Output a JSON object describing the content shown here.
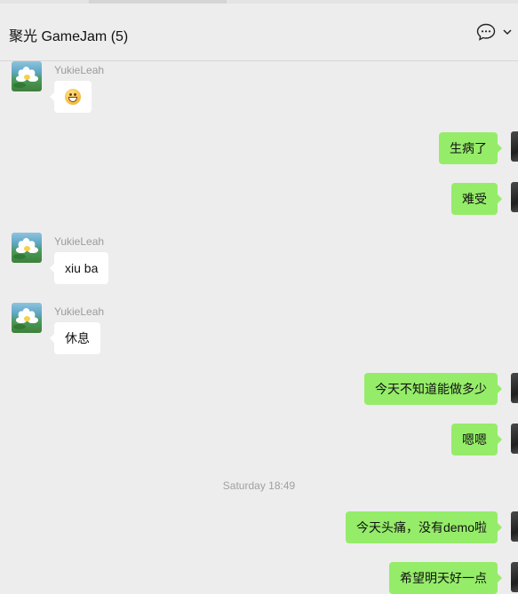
{
  "header": {
    "title": "聚光 GameJam (5)",
    "icons": [
      "chat-bubble-icon",
      "chevron-down-icon"
    ]
  },
  "messages": [
    {
      "sender": "YukieLeah",
      "direction": "in",
      "content": "😄",
      "content_type": "emoji"
    },
    {
      "direction": "out",
      "content": "生病了"
    },
    {
      "direction": "out",
      "content": "难受"
    },
    {
      "sender": "YukieLeah",
      "direction": "in",
      "content": "xiu ba"
    },
    {
      "sender": "YukieLeah",
      "direction": "in",
      "content": "休息"
    },
    {
      "direction": "out",
      "content": "今天不知道能做多少"
    },
    {
      "direction": "out",
      "content": "嗯嗯"
    },
    {
      "direction": "out",
      "content": "今天头痛，没有demo啦"
    },
    {
      "direction": "out",
      "content": "希望明天好一点"
    }
  ],
  "timestamp": "Saturday 18:49",
  "colors": {
    "background": "#ededed",
    "incoming_bubble": "#ffffff",
    "outgoing_bubble": "#95ec69",
    "sender_name": "#9b9b9b"
  }
}
